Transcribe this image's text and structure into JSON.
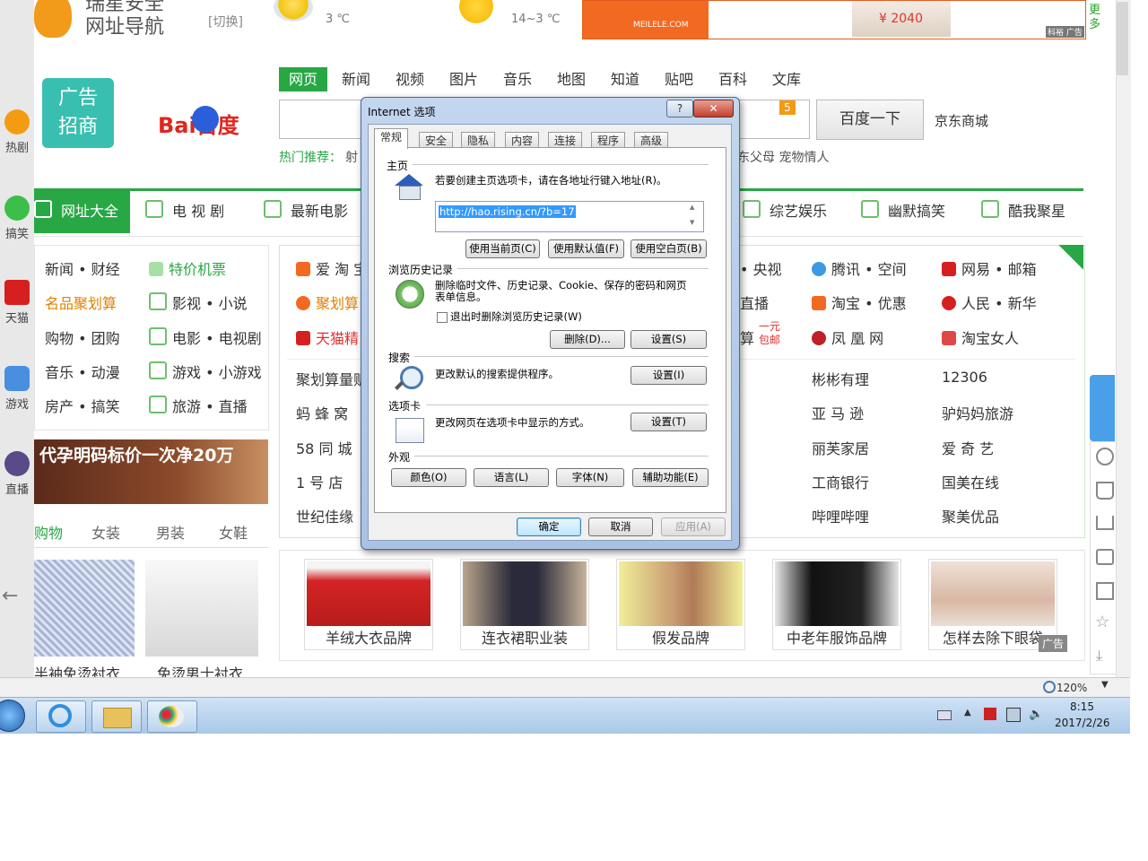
{
  "header": {
    "brand_line1": "瑞星安全",
    "brand_line2": "网址导航",
    "switch_label": "[切换]",
    "weather": [
      {
        "temp": "3 ℃"
      },
      {
        "temp": "14~3 ℃"
      }
    ],
    "ad_brand": "MEILELE.COM",
    "ad_price": "¥ 2040",
    "ad_tag": "科裕 广告",
    "more_label": "更多"
  },
  "ad_tile": {
    "line1": "广告",
    "line2": "招商"
  },
  "baidu_logo": "Bai百度",
  "search": {
    "tabs": [
      "网页",
      "新闻",
      "视频",
      "图片",
      "音乐",
      "地图",
      "知道",
      "贴吧",
      "百科",
      "文库"
    ],
    "active_tab": "网页",
    "button": "百度一下",
    "badge": "5",
    "side_link": "京东商城",
    "hot_label": "热门推荐：",
    "hot_prefix": "射",
    "hot_suffix": "东父母 宠物情人"
  },
  "categories": [
    "网址大全",
    "电 视 剧",
    "最新电影",
    "综艺娱乐",
    "幽默搞笑",
    "酷我聚星"
  ],
  "left_links": [
    [
      "新闻 • 财经",
      "特价机票"
    ],
    [
      "名品聚划算",
      "影视 • 小说"
    ],
    [
      "购物 • 团购",
      "电影 • 电视剧"
    ],
    [
      "音乐 • 动漫",
      "游戏 • 小游戏"
    ],
    [
      "房产 • 搞笑",
      "旅游 • 直播"
    ]
  ],
  "left_banner": "代孕明码标价一次净20万",
  "shop_tabs": [
    "购物",
    "女装",
    "男装",
    "女鞋"
  ],
  "shop_items": [
    "半袖免烫衬衣",
    "免烫男士衬衣"
  ],
  "sidebar_left": [
    "热剧",
    "搞笑",
    "天猫",
    "游戏",
    "直播"
  ],
  "main_links": {
    "row1": [
      "爱 淘 宝",
      "• 央视",
      "腾讯 • 空间",
      "网易 • 邮箱"
    ],
    "row2": [
      "聚划算",
      "直播",
      "淘宝 • 优惠",
      "人民 • 新华"
    ],
    "row3": [
      "天猫精",
      "算",
      "凤 凰 网",
      "淘宝女人"
    ],
    "yiyuan": "一元包邮",
    "grid": [
      [
        "聚划算量贩",
        "彬彬有理",
        "12306"
      ],
      [
        "蚂 蜂 窝",
        "亚 马 逊",
        "驴妈妈旅游"
      ],
      [
        "58 同 城",
        "丽芙家居",
        "爱 奇 艺"
      ],
      [
        "1 号 店",
        "工商银行",
        "国美在线"
      ],
      [
        "世纪佳缘",
        "哔哩哔哩",
        "聚美优品"
      ]
    ]
  },
  "products": [
    "羊绒大衣品牌",
    "连衣裙职业装",
    "假发品牌",
    "中老年服饰品牌",
    "怎样去除下眼袋"
  ],
  "products_ad": "广告",
  "status": {
    "zoom": "120%"
  },
  "clock": {
    "time": "8:15",
    "date": "2017/2/26"
  },
  "dialog": {
    "title": "Internet 选项",
    "help": "?",
    "close": "✕",
    "tabs": [
      "常规",
      "安全",
      "隐私",
      "内容",
      "连接",
      "程序",
      "高级"
    ],
    "active_tab": "常规",
    "home": {
      "label": "主页",
      "desc": "若要创建主页选项卡，请在各地址行键入地址(R)。",
      "url": "http://hao.rising.cn/?b=17",
      "btn_current": "使用当前页(C)",
      "btn_default": "使用默认值(F)",
      "btn_blank": "使用空白页(B)"
    },
    "history": {
      "label": "浏览历史记录",
      "desc": "删除临时文件、历史记录、Cookie、保存的密码和网页表单信息。",
      "checkbox": "退出时删除浏览历史记录(W)",
      "checked": false,
      "btn_delete": "删除(D)...",
      "btn_settings": "设置(S)"
    },
    "search": {
      "label": "搜索",
      "desc": "更改默认的搜索提供程序。",
      "btn_settings": "设置(I)"
    },
    "tabs_group": {
      "label": "选项卡",
      "desc": "更改网页在选项卡中显示的方式。",
      "btn_settings": "设置(T)"
    },
    "appearance": {
      "label": "外观",
      "btn_colors": "颜色(O)",
      "btn_languages": "语言(L)",
      "btn_fonts": "字体(N)",
      "btn_accessibility": "辅助功能(E)"
    },
    "btn_ok": "确定",
    "btn_cancel": "取消",
    "btn_apply": "应用(A)"
  }
}
